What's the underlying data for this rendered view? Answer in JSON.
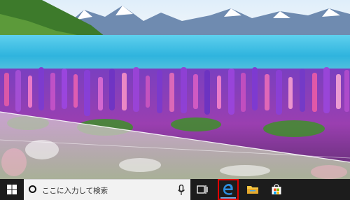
{
  "wallpaper": {
    "colors": {
      "sky": "#eaf3fa",
      "lake": "#3cc3e6",
      "lupine_purple": "#8a3cc8",
      "lupine_pink": "#e85ab4",
      "foliage": "#3f8f2a"
    }
  },
  "taskbar": {
    "background": "#1c1c1c",
    "start": {
      "icon": "windows-logo-icon"
    },
    "search": {
      "placeholder": "ここに入力して検索",
      "icon": "cortana-circle-icon",
      "mic_icon": "microphone-icon"
    },
    "pinned": [
      {
        "name": "task-view",
        "icon": "task-view-icon"
      },
      {
        "name": "microsoft-edge",
        "icon": "edge-e-icon",
        "highlight_color": "#e00000"
      },
      {
        "name": "file-explorer",
        "icon": "folder-icon"
      },
      {
        "name": "microsoft-store",
        "icon": "store-bag-icon"
      }
    ]
  }
}
